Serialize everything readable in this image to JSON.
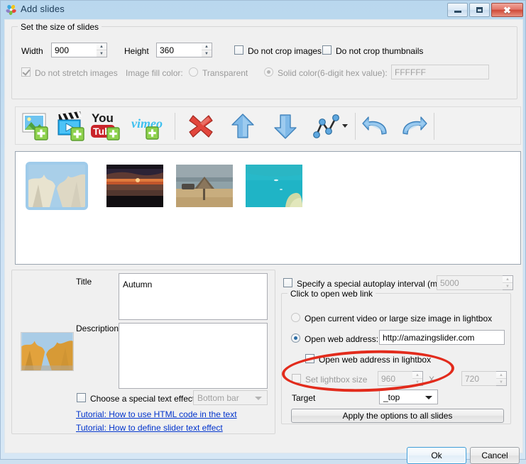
{
  "window": {
    "title": "Add slides",
    "icon": "app-flower-icon",
    "controls": {
      "minimize": "minimize-icon",
      "maximize": "maximize-icon",
      "close": "close-icon"
    }
  },
  "size_group": {
    "legend": "Set the size of slides",
    "width_label": "Width",
    "width_value": "900",
    "height_label": "Height",
    "height_value": "360",
    "do_not_crop_images": "Do not crop images",
    "do_not_crop_images_checked": false,
    "do_not_crop_thumbnails": "Do not crop thumbnails",
    "do_not_crop_thumbnails_checked": false,
    "do_not_stretch_images": "Do not stretch images",
    "do_not_stretch_images_checked": true,
    "image_fill_color_label": "Image fill color:",
    "transparent_label": "Transparent",
    "solid_color_label": "Solid color(6-digit hex value):",
    "solid_color_value": "FFFFFF",
    "fill_selected": "solid"
  },
  "toolbar": {
    "items": [
      {
        "name": "add-image-icon",
        "tip": "Add images"
      },
      {
        "name": "add-video-icon",
        "tip": "Add videos"
      },
      {
        "name": "add-youtube-icon",
        "tip": "Add YouTube video"
      },
      {
        "name": "add-vimeo-icon",
        "tip": "Add Vimeo video"
      },
      {
        "name": "delete-icon",
        "tip": "Delete slide"
      },
      {
        "name": "move-up-icon",
        "tip": "Move up"
      },
      {
        "name": "move-down-icon",
        "tip": "Move down"
      },
      {
        "name": "transition-icon",
        "tip": "Slide transition"
      },
      {
        "name": "undo-icon",
        "tip": "Undo"
      },
      {
        "name": "redo-icon",
        "tip": "Redo"
      }
    ]
  },
  "slides": [
    {
      "name": "slide-thumb-autumn",
      "alt": "Autumn trees against blue sky",
      "selected": true
    },
    {
      "name": "slide-thumb-sunset",
      "alt": "Sunset over the sea",
      "selected": false
    },
    {
      "name": "slide-thumb-beach",
      "alt": "Beach umbrella hut",
      "selected": false
    },
    {
      "name": "slide-thumb-lagoon",
      "alt": "Turquoise lagoon from above",
      "selected": false
    }
  ],
  "details": {
    "title_label": "Title",
    "title_value": "Autumn",
    "description_label": "Description",
    "description_value": "",
    "preview_alt": "Autumn trees thumbnail",
    "text_effect_checkbox": "Choose a special text effect",
    "text_effect_checked": false,
    "text_effect_value": "Bottom bar",
    "tutorial_html_link": "Tutorial: How to use HTML code in the text",
    "tutorial_effect_link": "Tutorial: How to define slider text effect"
  },
  "options": {
    "autoplay_label": "Specify a special autoplay interval (ms):",
    "autoplay_checked": false,
    "autoplay_value": "5000",
    "weblink_legend": "Click to open web link",
    "open_lightbox_label": "Open current video or large size image in lightbox",
    "open_weblink_label": "Open web address:",
    "weblink_selection": "weblink",
    "weblink_value": "http://amazingslider.com",
    "open_in_lightbox_label": "Open web address in lightbox",
    "open_in_lightbox_checked": false,
    "set_lightbox_size_label": "Set lightbox size",
    "set_lightbox_size_checked": false,
    "lightbox_width": "960",
    "lightbox_x": "X",
    "lightbox_height": "720",
    "target_label": "Target",
    "target_value": "_top",
    "apply_all_label": "Apply the options to all slides"
  },
  "footer": {
    "ok_label": "Ok",
    "cancel_label": "Cancel"
  },
  "annotation": {
    "name": "red-ellipse-highlight",
    "color": "#e22b1c"
  }
}
